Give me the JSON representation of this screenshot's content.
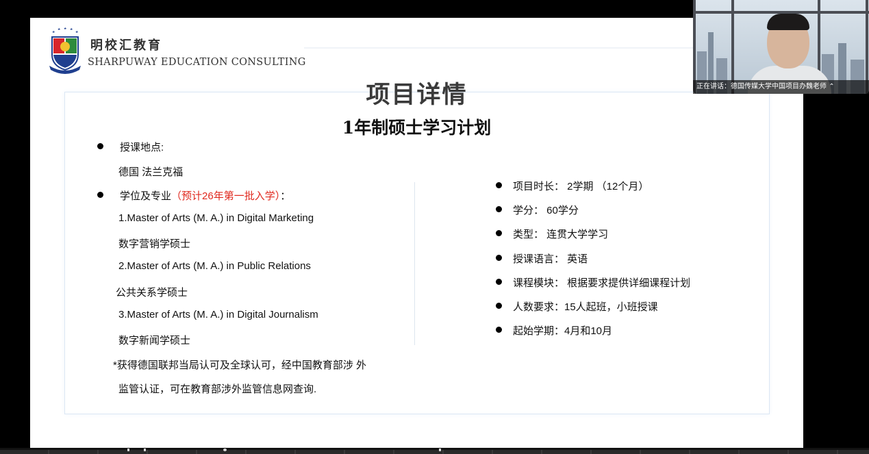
{
  "brand": {
    "name_cn": "明校汇教育",
    "name_en": "SHARPUWAY EDUCATION CONSULTING"
  },
  "slide": {
    "title": "项目详情",
    "subtitle": "1年制硕士学习计划",
    "left": {
      "location_label": "授课地点:",
      "location_value": "德国 法兰克福",
      "degree_label": "学位及专业",
      "degree_note": "（预计26年第一批入学）",
      "degree_colon": "：",
      "programs": [
        {
          "en": "1.Master of Arts (M. A.) in Digital Marketing",
          "cn": "数字营销学硕士"
        },
        {
          "en": "2.Master of Arts (M. A.) in Public Relations",
          "cn": "公共关系学硕士"
        },
        {
          "en": "3.Master of Arts (M. A.) in Digital Journalism",
          "cn": "数字新闻学硕士"
        }
      ],
      "note_line1": "*获得德国联邦当局认可及全球认可，经中国教育部涉 外",
      "note_line2": "监管认证，可在教育部涉外监管信息网查询."
    },
    "right": {
      "items": [
        "项目时长： 2学期 （12个月）",
        "学分： 60学分",
        "类型： 连贯大学学习",
        "授课语言： 英语",
        "课程模块： 根据要求提供详细课程计划",
        "人数要求：15人起班，小班授课",
        "起始学期：4月和10月"
      ]
    }
  },
  "video": {
    "speaker_caption": "正在讲话：德国传媒大学中国项目办魏老师",
    "expand_icon": "chevron-up-icon"
  },
  "colors": {
    "accent_red": "#e0281d",
    "logo_blue": "#1f3f8f",
    "logo_red": "#d8262b",
    "logo_green": "#2e8b3d"
  }
}
